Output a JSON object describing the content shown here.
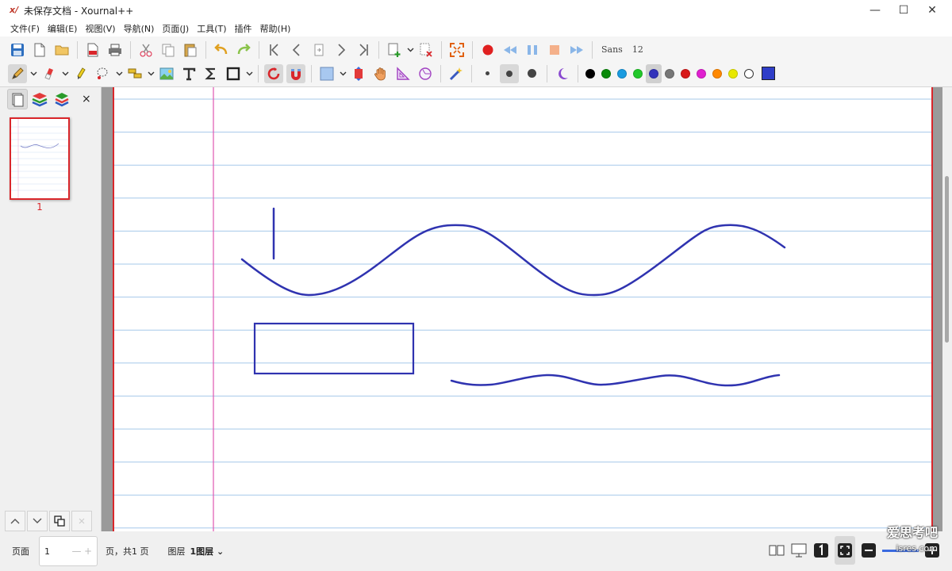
{
  "window": {
    "title": "未保存文档 - Xournal++",
    "logo": "x/",
    "minimize": "—",
    "maximize": "☐",
    "close": "✕"
  },
  "menu": [
    "文件(F)",
    "编辑(E)",
    "视图(V)",
    "导航(N)",
    "页面(J)",
    "工具(T)",
    "插件",
    "帮助(H)"
  ],
  "toolbar": {
    "font_name": "Sans",
    "font_size": "12",
    "colors": [
      "#000000",
      "#0a8a0a",
      "#1a9be0",
      "#22c82a",
      "#3333bb",
      "#777777",
      "#d81818",
      "#e020d0",
      "#ff8800",
      "#e8e800",
      "#ffffff"
    ],
    "selected_color": "#3333bb",
    "custom_color": "#2f3ec8"
  },
  "sidebar": {
    "close_label": "×",
    "thumbnail_page": "1"
  },
  "status": {
    "page_label": "页面",
    "page_value": "1",
    "spin_minus": "—",
    "spin_plus": "+",
    "page_total": "页，共1 页",
    "layer_label": "图层",
    "layer_value": "1图层",
    "layer_dropdown": "⌄"
  },
  "watermark": {
    "main": "爱思考吧",
    "sub": "isres.com"
  },
  "colors": {
    "ink": "#2f33b0",
    "margin_line": "#e056b0",
    "rule_line": "#a6c8ea",
    "page_border": "#d9262b"
  }
}
